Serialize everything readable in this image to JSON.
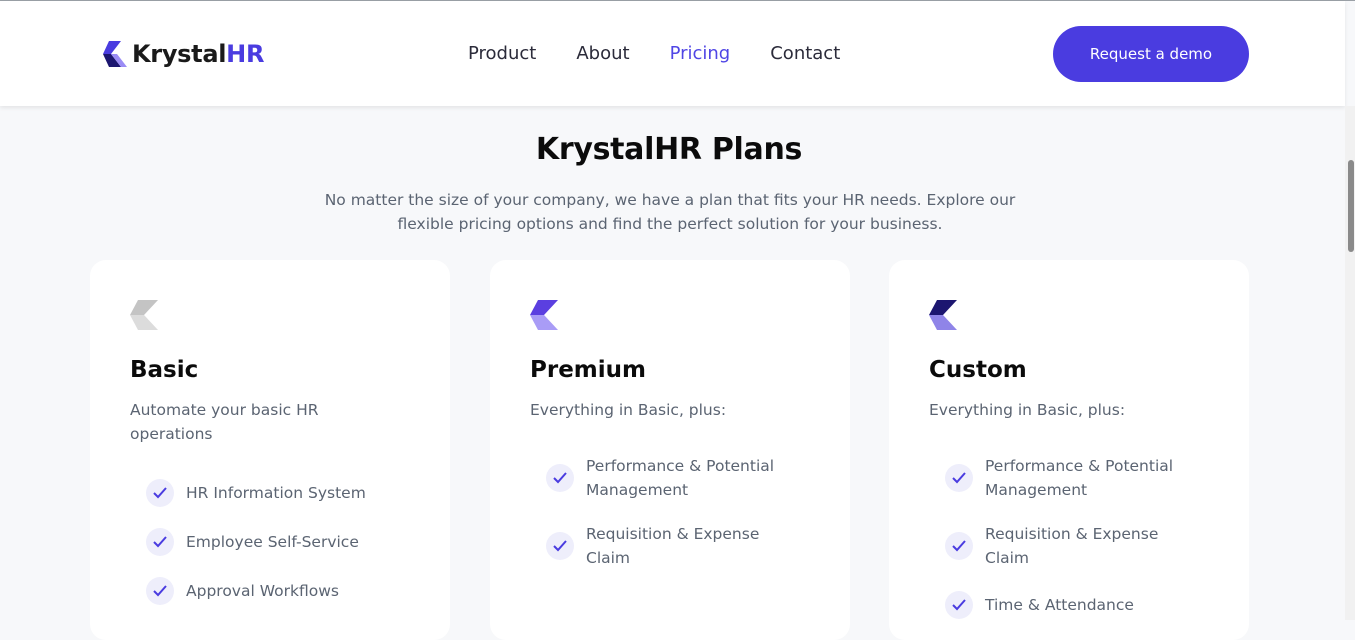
{
  "brand": {
    "name_main": "Krystal",
    "name_accent": "HR"
  },
  "nav": {
    "items": [
      {
        "label": "Product"
      },
      {
        "label": "About"
      },
      {
        "label": "Pricing",
        "active": true
      },
      {
        "label": "Contact"
      }
    ],
    "cta_label": "Request a demo"
  },
  "hero": {
    "title": "KrystalHR Plans",
    "subtitle": "No matter the size of your company, we have a plan that fits your HR needs. Explore our flexible pricing options and find the perfect solution for your business."
  },
  "plans": [
    {
      "name": "Basic",
      "description": "Automate your basic HR operations",
      "icon": "basic-plan-icon",
      "features": [
        "HR Information System",
        "Employee Self-Service",
        "Approval Workflows"
      ]
    },
    {
      "name": "Premium",
      "description": "Everything in Basic, plus:",
      "icon": "premium-plan-icon",
      "features": [
        "Performance & Potential Management",
        "Requisition & Expense Claim"
      ]
    },
    {
      "name": "Custom",
      "description": "Everything in Basic, plus:",
      "icon": "custom-plan-icon",
      "features": [
        "Performance & Potential Management",
        "Requisition & Expense Claim",
        "Time & Attendance"
      ]
    }
  ],
  "colors": {
    "accent": "#4a3ce0",
    "nav_active": "#5046e5",
    "muted_text": "#5b6472",
    "check_bg": "#eeeefb",
    "basic_icon": "#c4c4c4",
    "premium_icon": "#5b3fe0",
    "custom_icon": "#1c1670"
  }
}
